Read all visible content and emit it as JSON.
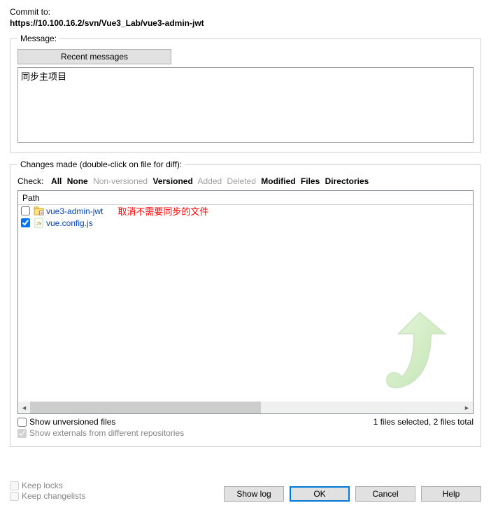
{
  "commit_to_label": "Commit to:",
  "commit_url": "https://10.100.16.2/svn/Vue3_Lab/vue3-admin-jwt",
  "message_section": {
    "legend": "Message:",
    "recent_btn": "Recent messages",
    "text": "同步主项目"
  },
  "changes_section": {
    "legend": "Changes made (double-click on file for diff):",
    "check_label": "Check:",
    "filters": {
      "all": "All",
      "none": "None",
      "non_versioned": "Non-versioned",
      "versioned": "Versioned",
      "added": "Added",
      "deleted": "Deleted",
      "modified": "Modified",
      "files": "Files",
      "directories": "Directories"
    },
    "path_header": "Path",
    "files": [
      {
        "checked": false,
        "name": "vue3-admin-jwt",
        "annotation": "取消不需要同步的文件",
        "icon": "folder"
      },
      {
        "checked": true,
        "name": "vue.config.js",
        "annotation": "",
        "icon": "js"
      }
    ],
    "show_unversioned": "Show unversioned files",
    "show_externals": "Show externals from different repositories",
    "status": "1 files selected, 2 files total"
  },
  "bottom": {
    "keep_locks": "Keep locks",
    "keep_changelists": "Keep changelists",
    "show_log": "Show log",
    "ok": "OK",
    "cancel": "Cancel",
    "help": "Help"
  }
}
